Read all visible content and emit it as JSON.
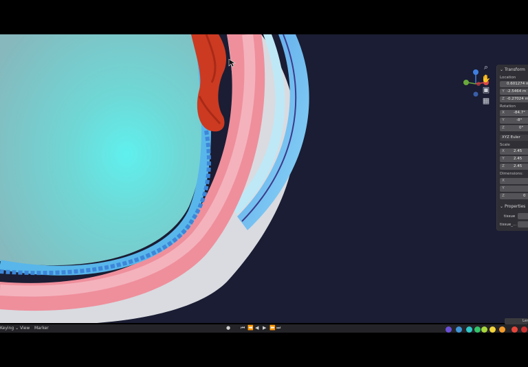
{
  "viewport": {
    "tools": [
      {
        "icon": "zoom-icon",
        "glyph": "⌕"
      },
      {
        "icon": "pan-hand-icon",
        "glyph": "✋"
      },
      {
        "icon": "camera-icon",
        "glyph": "▣"
      },
      {
        "icon": "grid-icon",
        "glyph": "▦"
      }
    ]
  },
  "npanel": {
    "transform_header": "Transform",
    "location_label": "Location",
    "location": [
      {
        "axis": "",
        "value": "0.601274 m"
      },
      {
        "axis": "Y",
        "value": "-2.5464 m"
      },
      {
        "axis": "Z",
        "value": "-0.27024 m"
      }
    ],
    "rotation_label": "Rotation",
    "rotation": [
      {
        "axis": "X",
        "value": "-84.7°"
      },
      {
        "axis": "Y",
        "value": "-8°"
      },
      {
        "axis": "Z",
        "value": "0°"
      }
    ],
    "rotation_mode": "XYZ Euler",
    "scale_label": "Scale",
    "scale": [
      {
        "axis": "X",
        "value": "2.45"
      },
      {
        "axis": "Y",
        "value": "2.45"
      },
      {
        "axis": "Z",
        "value": "2.45"
      }
    ],
    "dimensions_label": "Dimensions:",
    "dimensions": [
      {
        "axis": "X",
        "value": ""
      },
      {
        "axis": "Y",
        "value": ""
      },
      {
        "axis": "Z",
        "value": "0"
      }
    ],
    "properties_header": "Properties",
    "props": [
      "tissue",
      "tissue_..."
    ]
  },
  "timeline": {
    "menus": [
      "Keying ⌄",
      "View",
      "Marker"
    ],
    "controls": [
      "●",
      "⏮",
      "⏪",
      "◀",
      "▶",
      "⏩",
      "⏭"
    ],
    "right_field": "Len",
    "swatches": [
      "#6a4fd6",
      "#3f95d6",
      "#2fc7c7",
      "#31c46a",
      "#a8d83a",
      "#f2d43a",
      "#f39a2a",
      "#e8453a",
      "#c93030"
    ]
  }
}
